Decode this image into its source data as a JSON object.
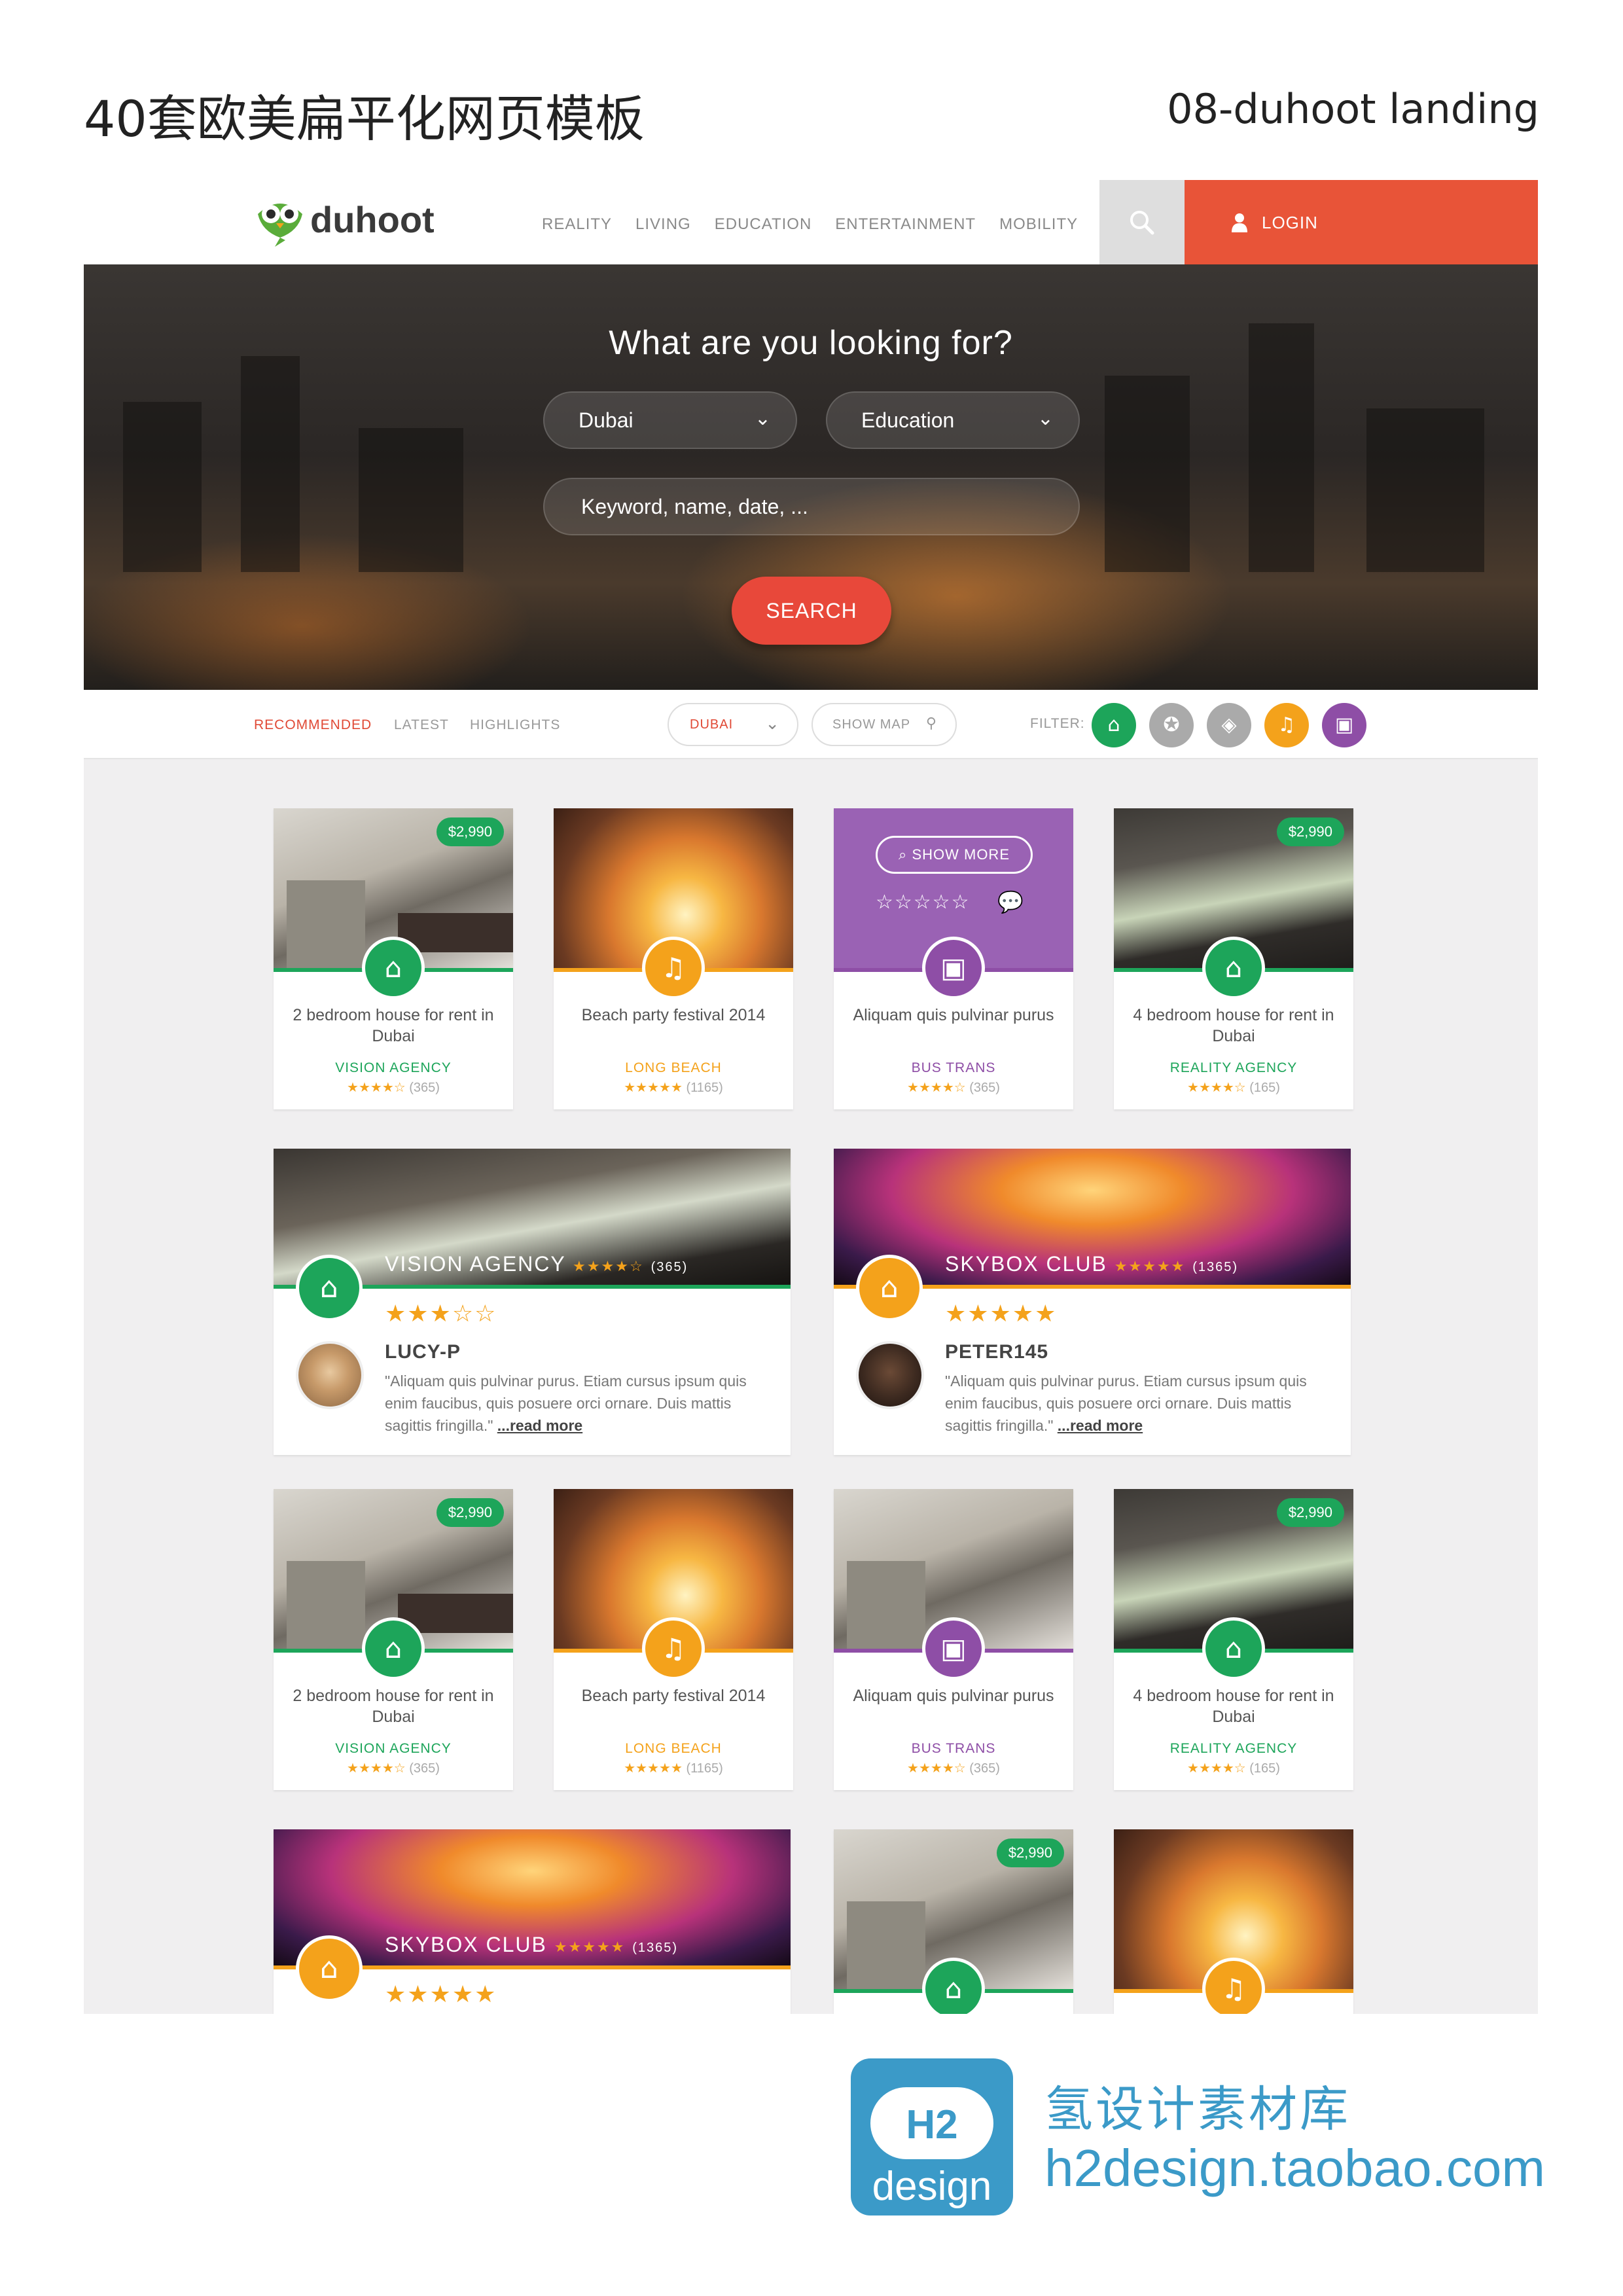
{
  "page_header": {
    "left": "40套欧美扁平化网页模板",
    "right": "08-duhoot landing"
  },
  "nav": {
    "logo_text": "duhoot",
    "menu": [
      "REALITY",
      "LIVING",
      "EDUCATION",
      "ENTERTAINMENT",
      "MOBILITY"
    ],
    "search_icon": "search-icon",
    "login_label": "LOGIN"
  },
  "hero": {
    "title": "What are you looking for?",
    "city": "Dubai",
    "category": "Education",
    "keyword_placeholder": "Keyword, name, date, ...",
    "search_label": "SEARCH"
  },
  "toolbar": {
    "tabs": [
      "RECOMMENDED",
      "LATEST",
      "HIGHLIGHTS"
    ],
    "city": "DUBAI",
    "show_map": "SHOW MAP",
    "filter_label": "FILTER:"
  },
  "colors": {
    "green": "#1da55a",
    "orange": "#f4a21b",
    "purple": "#8e4ea6",
    "red": "#e8483a",
    "gray": "#a8a8a8"
  },
  "cards": [
    {
      "price": "$2,990",
      "title": "2 bedroom house for rent in Dubai",
      "agency": "VISION AGENCY",
      "count": "(365)",
      "stars": 4,
      "type": "home",
      "color": "#1da55a"
    },
    {
      "price": "",
      "title": "Beach party festival 2014",
      "agency": "LONG BEACH",
      "count": "(1165)",
      "stars": 5,
      "type": "music",
      "color": "#f4a21b"
    },
    {
      "price": "",
      "title": "Aliquam quis pulvinar purus",
      "agency": "BUS TRANS",
      "count": "(365)",
      "stars": 4,
      "type": "bus",
      "color": "#8e4ea6",
      "overlay": "SHOW MORE"
    },
    {
      "price": "$2,990",
      "title": "4 bedroom house for rent in Dubai",
      "agency": "REALITY AGENCY",
      "count": "(165)",
      "stars": 4,
      "type": "home",
      "color": "#1da55a"
    }
  ],
  "reviews": [
    {
      "name": "VISION AGENCY",
      "count": "(365)",
      "user": "LUCY-P",
      "stars": 3,
      "quote": "\"Aliquam quis pulvinar purus. Etiam cursus ipsum quis enim faucibus, quis posuere orci ornare. Duis mattis sagittis fringilla.\"",
      "more": "...read more",
      "color": "#1da55a"
    },
    {
      "name": "SKYBOX CLUB",
      "count": "(1365)",
      "user": "PETER145",
      "stars": 5,
      "quote": "\"Aliquam quis pulvinar purus. Etiam cursus ipsum quis enim faucibus, quis posuere orci ornare. Duis mattis sagittis fringilla.\"",
      "more": "...read more",
      "color": "#f4a21b"
    }
  ],
  "bottom": {
    "club": "SKYBOX CLUB",
    "count": "(1365)",
    "price": "$2,990"
  },
  "brand": {
    "cn": "氢设计素材库",
    "url": "h2design.taobao.com",
    "logo_h2": "H2",
    "logo_word": "design"
  }
}
